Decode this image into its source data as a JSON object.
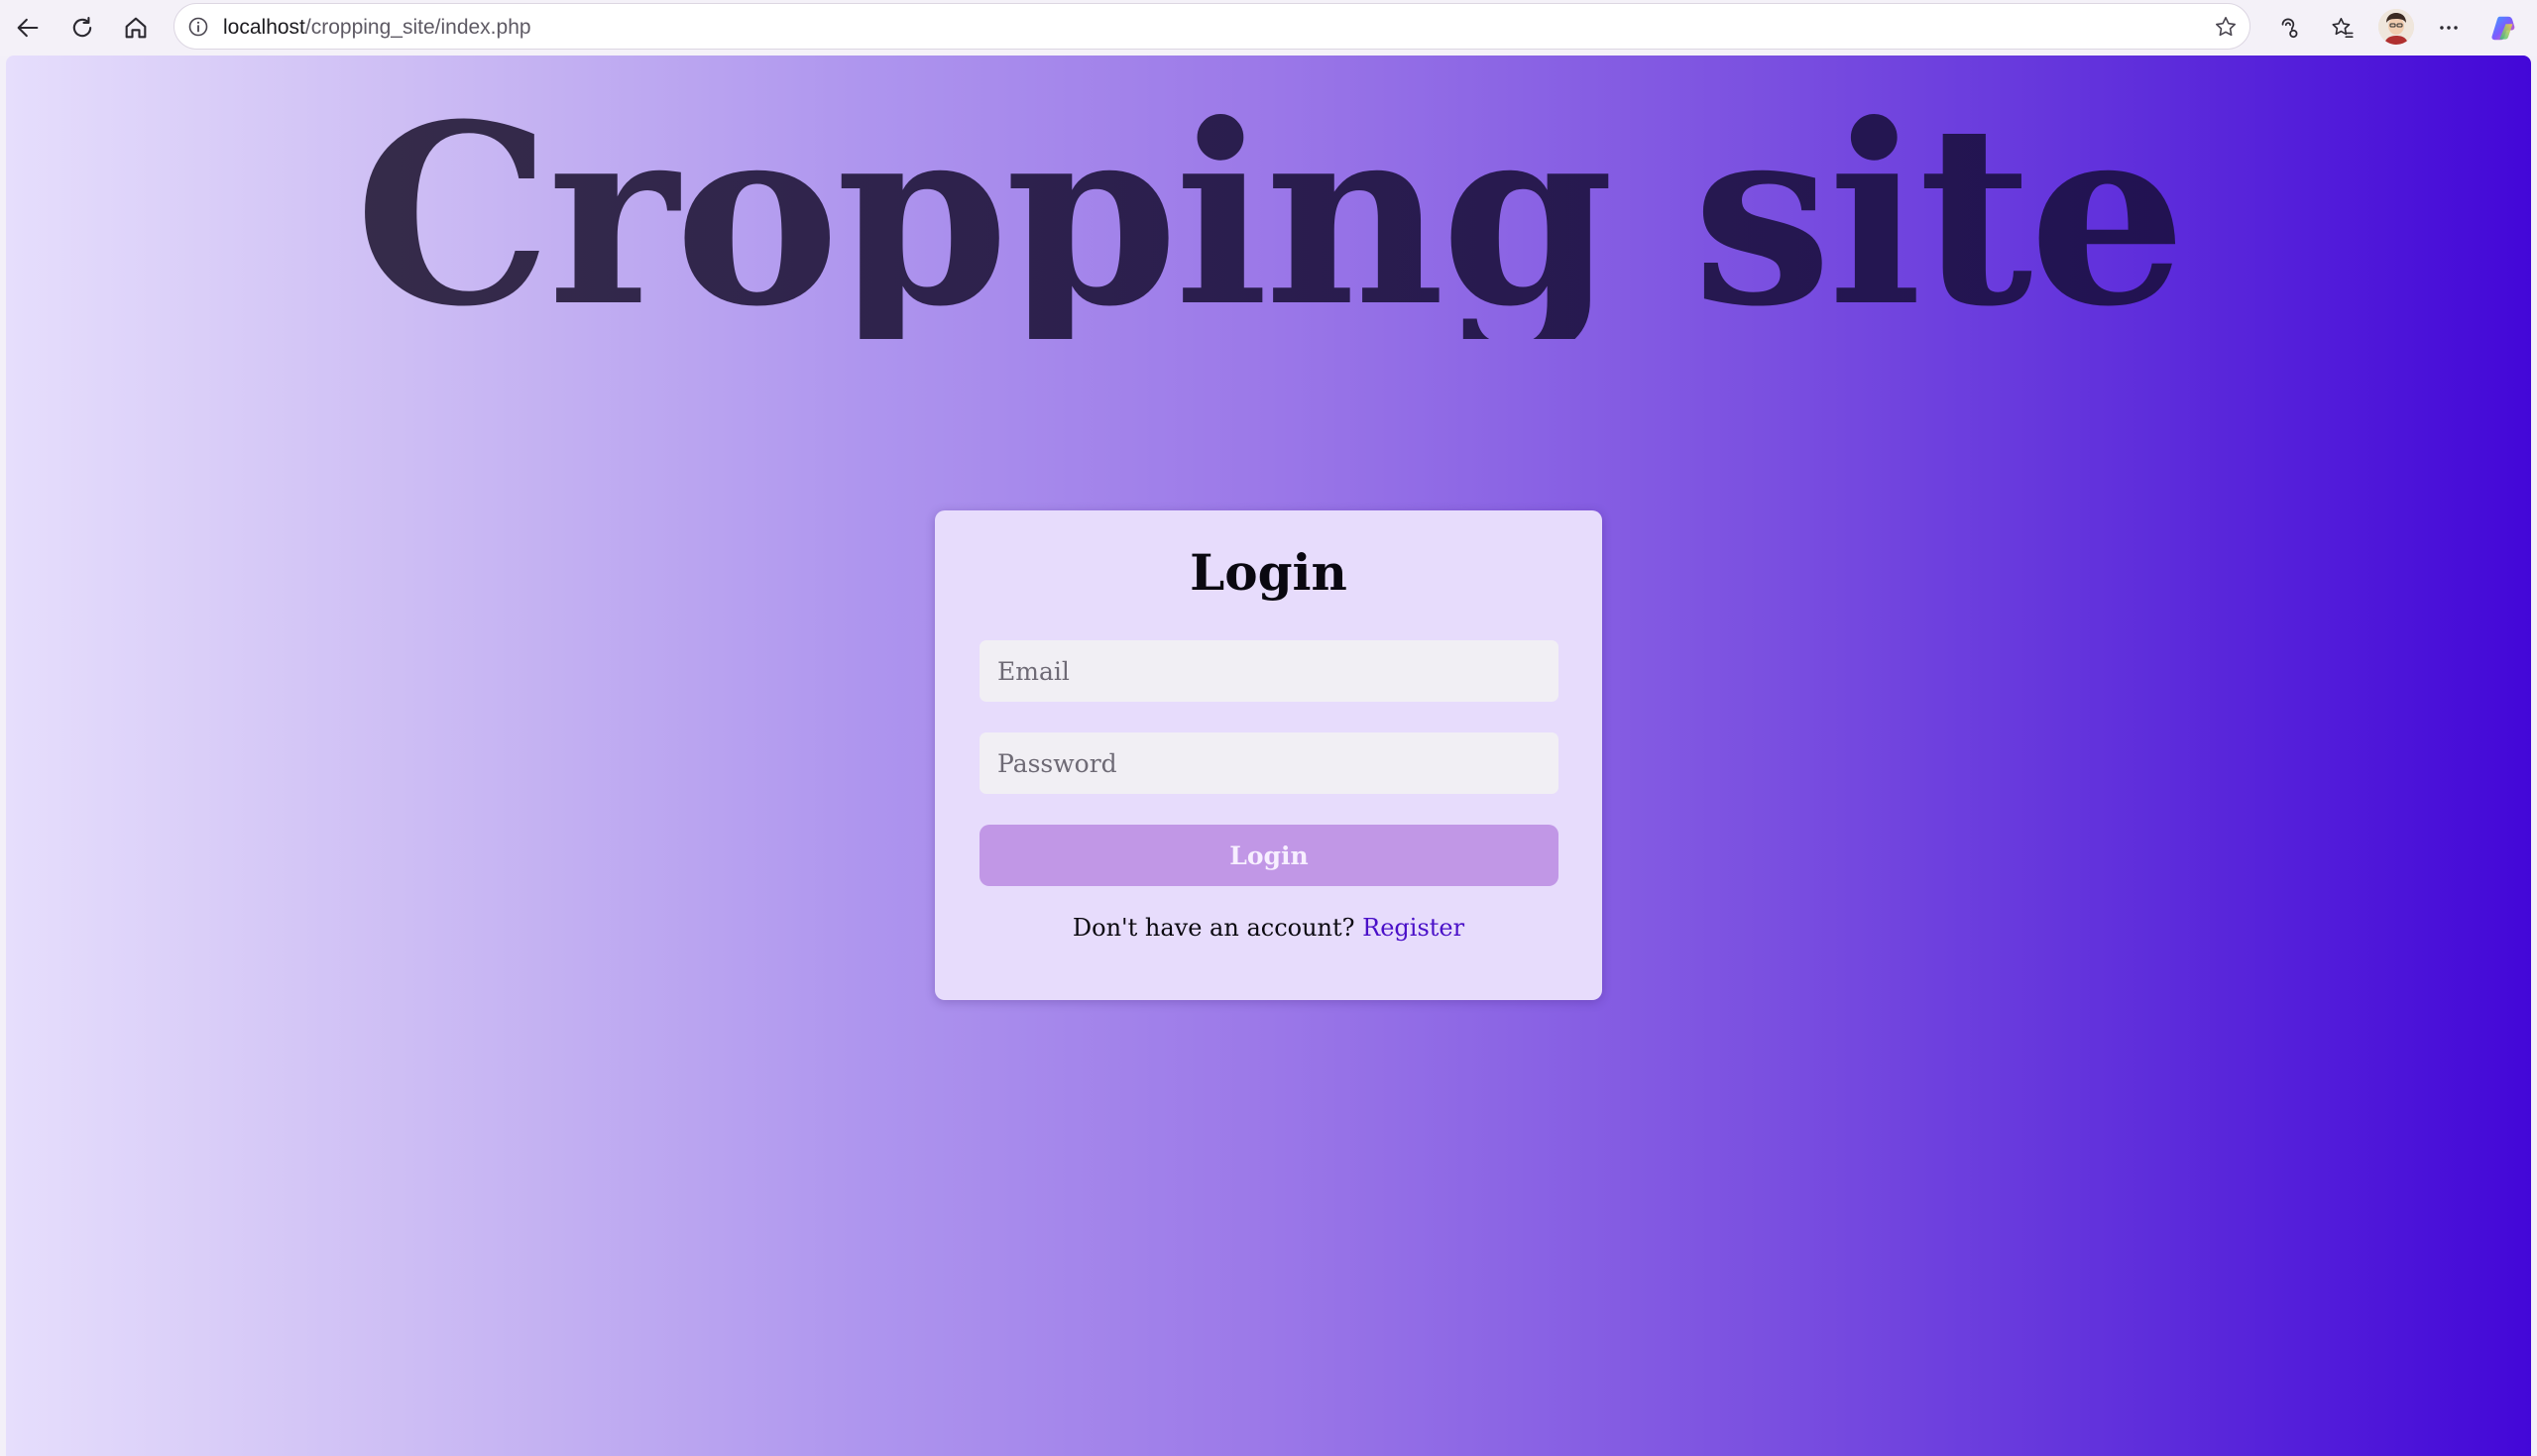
{
  "browser": {
    "url_host": "localhost",
    "url_path": "/cropping_site/index.php",
    "icons": [
      "back-icon",
      "refresh-icon",
      "home-icon",
      "site-info-icon",
      "favorite-star-icon",
      "read-aloud-icon",
      "favorites-icon",
      "profile-avatar",
      "more-icon",
      "copilot-icon"
    ]
  },
  "page": {
    "site_title": "Cropping site",
    "login": {
      "heading": "Login",
      "email_placeholder": "Email",
      "password_placeholder": "Password",
      "button_label": "Login",
      "register_prompt": "Don't have an account?",
      "register_link": "Register"
    }
  },
  "colors": {
    "gradient_start": "#e6defc",
    "gradient_end": "#4307d8",
    "card_background": "#e7dcfc",
    "button_background": "#c197e6",
    "link_color": "#4a10c8"
  }
}
